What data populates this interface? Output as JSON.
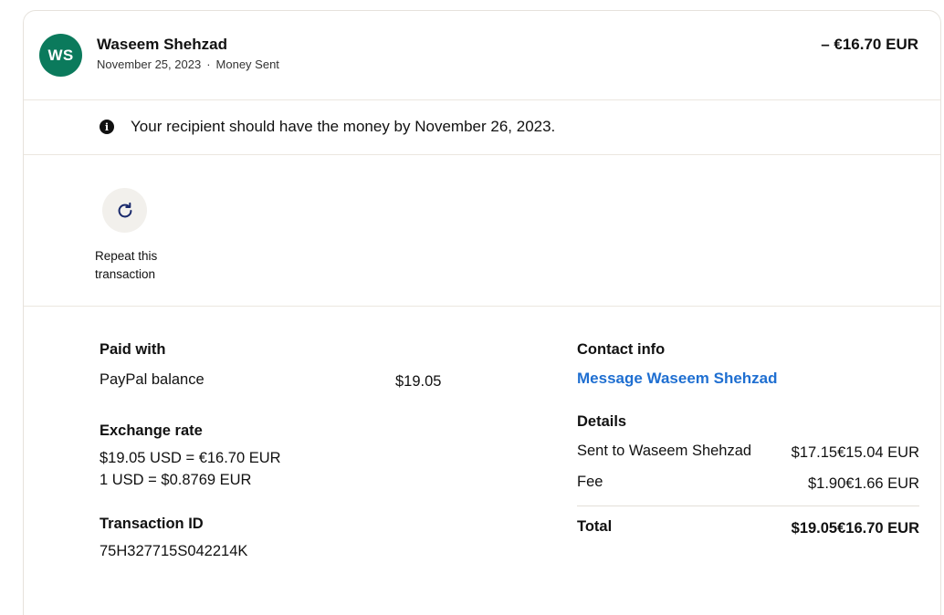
{
  "header": {
    "avatar_initials": "WS",
    "name": "Waseem Shehzad",
    "date": "November 25, 2023",
    "separator": "·",
    "type": "Money Sent",
    "amount": "– €16.70 EUR"
  },
  "notice": {
    "icon": "info-icon",
    "text": "Your recipient should have the money by November 26, 2023."
  },
  "actions": {
    "repeat": {
      "icon": "refresh-icon",
      "label_line1": "Repeat this",
      "label_line2": "transaction"
    }
  },
  "paid_with": {
    "title": "Paid with",
    "method": "PayPal balance",
    "amount": "$19.05"
  },
  "exchange_rate": {
    "title": "Exchange rate",
    "line1": "$19.05 USD = €16.70 EUR",
    "line2": "1 USD = $0.8769 EUR"
  },
  "transaction_id": {
    "title": "Transaction ID",
    "value": "75H327715S042214K"
  },
  "contact_info": {
    "title": "Contact info",
    "link": "Message Waseem Shehzad"
  },
  "details": {
    "title": "Details",
    "rows": [
      {
        "label": "Sent to Waseem Shehzad",
        "value": "$17.15€15.04 EUR"
      },
      {
        "label": "Fee",
        "value": "$1.90€1.66 EUR"
      }
    ],
    "total_label": "Total",
    "total_value": "$19.05€16.70 EUR"
  },
  "colors": {
    "avatar_bg": "#0b7a5c",
    "link": "#1f6fd1",
    "icon_accent": "#1a2a6c"
  }
}
